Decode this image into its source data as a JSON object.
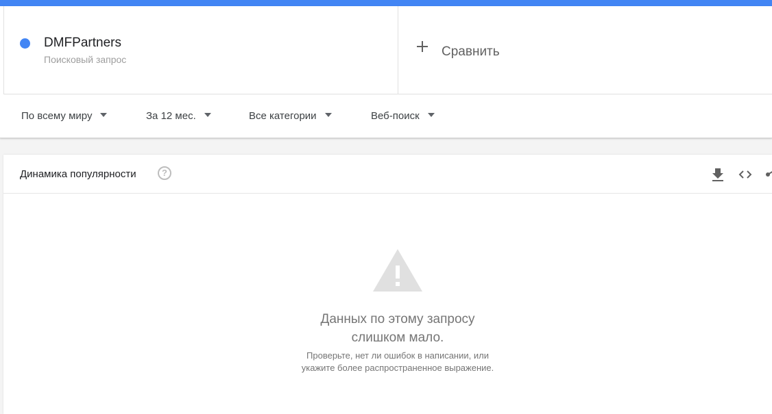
{
  "colors": {
    "accent": "#4285f4",
    "term_color": "#4285f4"
  },
  "term": {
    "name": "DMFPartners",
    "type": "Поисковый запрос"
  },
  "compare": {
    "icon": "plus-icon",
    "label": "Сравнить"
  },
  "filters": {
    "region": "По всему миру",
    "period": "За 12 мес.",
    "category": "Все категории",
    "search_type": "Веб-поиск"
  },
  "panel": {
    "title": "Динамика популярности",
    "help_glyph": "?",
    "tools": [
      "download-icon",
      "embed-code-icon",
      "share-icon"
    ]
  },
  "empty_state": {
    "icon": "warning-icon",
    "title_line1": "Данных по этому запросу",
    "title_line2": "слишком мало.",
    "hint_line1": "Проверьте, нет ли ошибок в написании, или",
    "hint_line2": "укажите более распространенное выражение."
  }
}
